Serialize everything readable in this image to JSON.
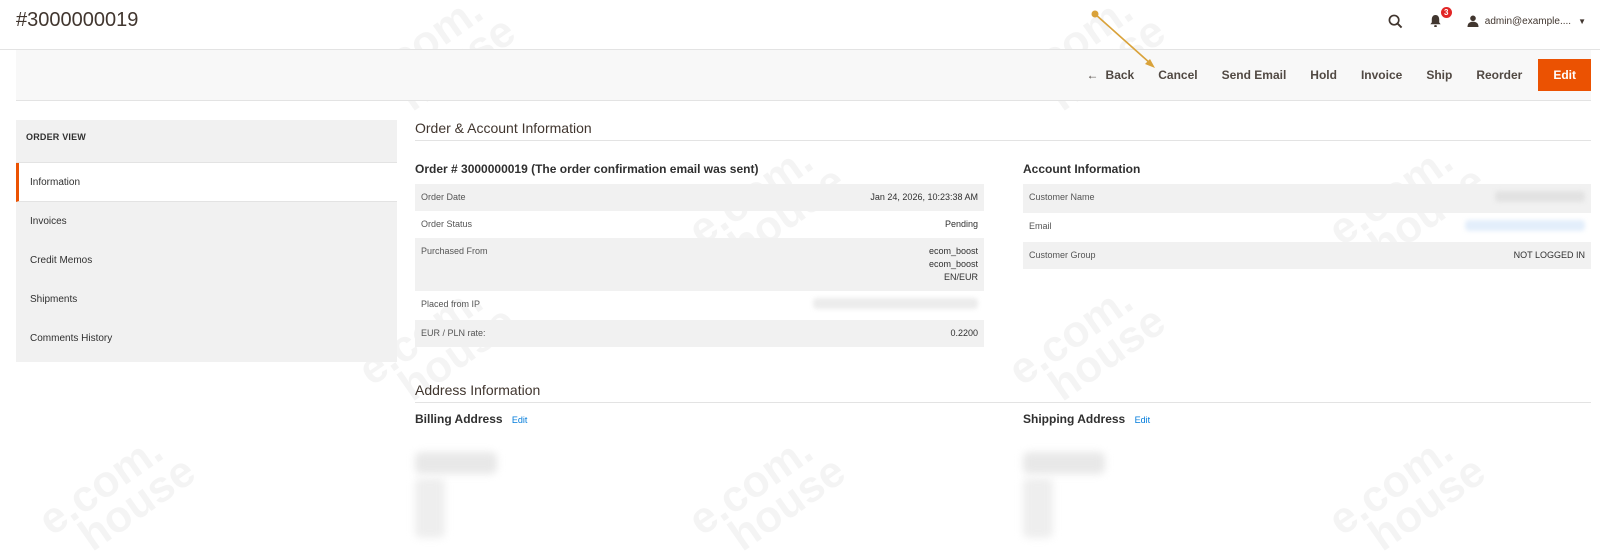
{
  "header": {
    "title": "#3000000019",
    "notification_count": "3",
    "user_name": "admin@example...."
  },
  "toolbar": {
    "back": "Back",
    "cancel": "Cancel",
    "send_email": "Send Email",
    "hold": "Hold",
    "invoice": "Invoice",
    "ship": "Ship",
    "reorder": "Reorder",
    "edit": "Edit"
  },
  "sidebar": {
    "title": "ORDER VIEW",
    "items": [
      {
        "label": "Information"
      },
      {
        "label": "Invoices"
      },
      {
        "label": "Credit Memos"
      },
      {
        "label": "Shipments"
      },
      {
        "label": "Comments History"
      }
    ]
  },
  "main": {
    "order_account_title": "Order & Account Information",
    "order_block_title": "Order # 3000000019 (The order confirmation email was sent)",
    "order_rows": [
      {
        "label": "Order Date",
        "value": "Jan 24, 2026, 10:23:38 AM"
      },
      {
        "label": "Order Status",
        "value": "Pending"
      },
      {
        "label": "Purchased From",
        "value_lines": [
          "ecom_boost",
          "ecom_boost",
          "EN/EUR"
        ]
      },
      {
        "label": "Placed from IP",
        "value": ""
      },
      {
        "label": "EUR / PLN rate:",
        "value": "0.2200"
      }
    ],
    "account_block_title": "Account Information",
    "account_rows": [
      {
        "label": "Customer Name",
        "value": ""
      },
      {
        "label": "Email",
        "value": ""
      },
      {
        "label": "Customer Group",
        "value": "NOT LOGGED IN"
      }
    ],
    "address_title": "Address Information",
    "billing_title": "Billing Address",
    "shipping_title": "Shipping Address",
    "edit_link": "Edit"
  },
  "colors": {
    "accent": "#eb5202",
    "link": "#007bdb",
    "badge": "#e22626",
    "annotation": "#d9a23a"
  },
  "watermark": "ecom. house"
}
